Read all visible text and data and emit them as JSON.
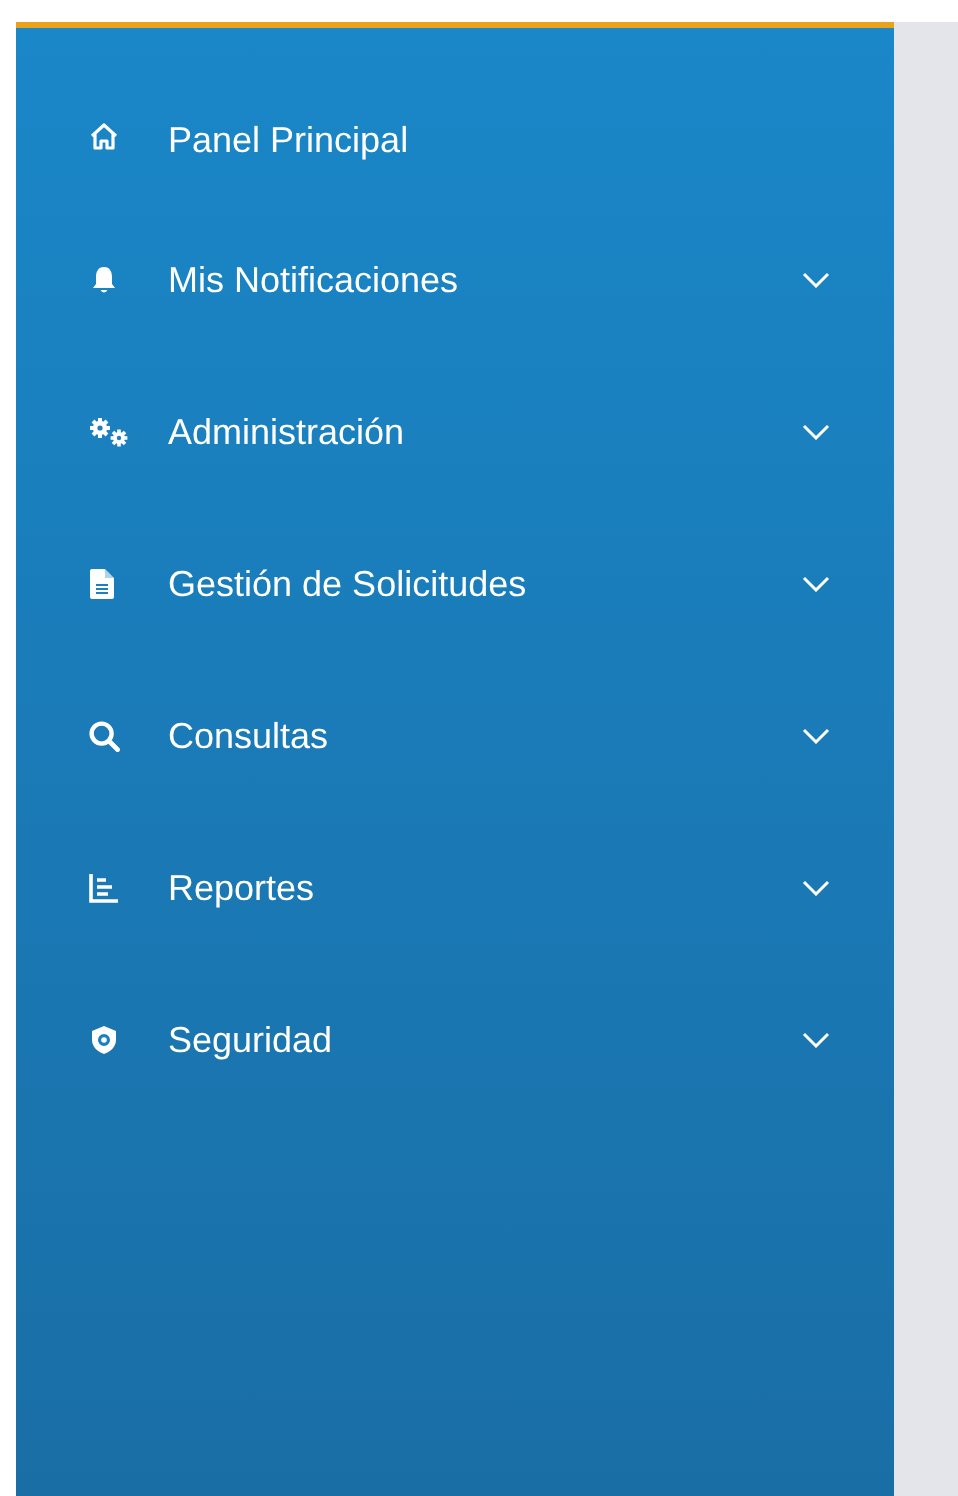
{
  "sidebar": {
    "items": [
      {
        "label": "Panel Principal",
        "has_submenu": false
      },
      {
        "label": "Mis Notificaciones",
        "has_submenu": true
      },
      {
        "label": "Administración",
        "has_submenu": true
      },
      {
        "label": "Gestión de Solicitudes",
        "has_submenu": true
      },
      {
        "label": "Consultas",
        "has_submenu": true
      },
      {
        "label": "Reportes",
        "has_submenu": true
      },
      {
        "label": "Seguridad",
        "has_submenu": true
      }
    ]
  }
}
